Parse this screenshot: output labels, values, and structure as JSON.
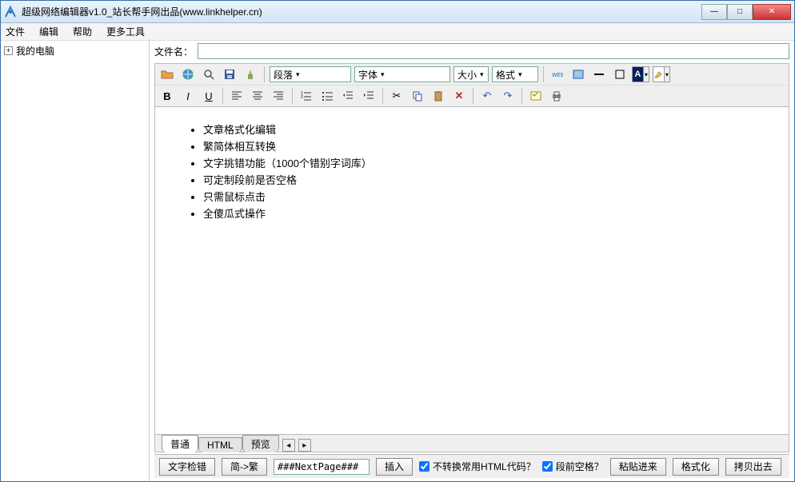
{
  "window": {
    "title": "超级网络编辑器v1.0_站长帮手网出品(www.linkhelper.cn)"
  },
  "menu": {
    "file": "文件",
    "edit": "编辑",
    "help": "帮助",
    "more": "更多工具"
  },
  "tree": {
    "root": "我的电脑"
  },
  "filerow": {
    "label": "文件名：",
    "value": ""
  },
  "combos": {
    "paragraph": "段落",
    "font": "字体",
    "size": "大小",
    "format": "格式"
  },
  "content": {
    "items": [
      "文章格式化编辑",
      "繁简体相互转换",
      "文字挑错功能（1000个错别字词库）",
      "可定制段前是否空格",
      "只需鼠标点击",
      "全傻瓜式操作"
    ]
  },
  "tabs": {
    "normal": "普通",
    "html": "HTML",
    "preview": "预览"
  },
  "bottom": {
    "spellcheck": "文字检错",
    "s2t": "简->繁",
    "nextpage": "###NextPage###",
    "insert": "插入",
    "chk_html": "不转换常用HTML代码？",
    "chk_space": "段前空格？",
    "paste_in": "粘贴进来",
    "format": "格式化",
    "copy_out": "拷贝出去"
  }
}
